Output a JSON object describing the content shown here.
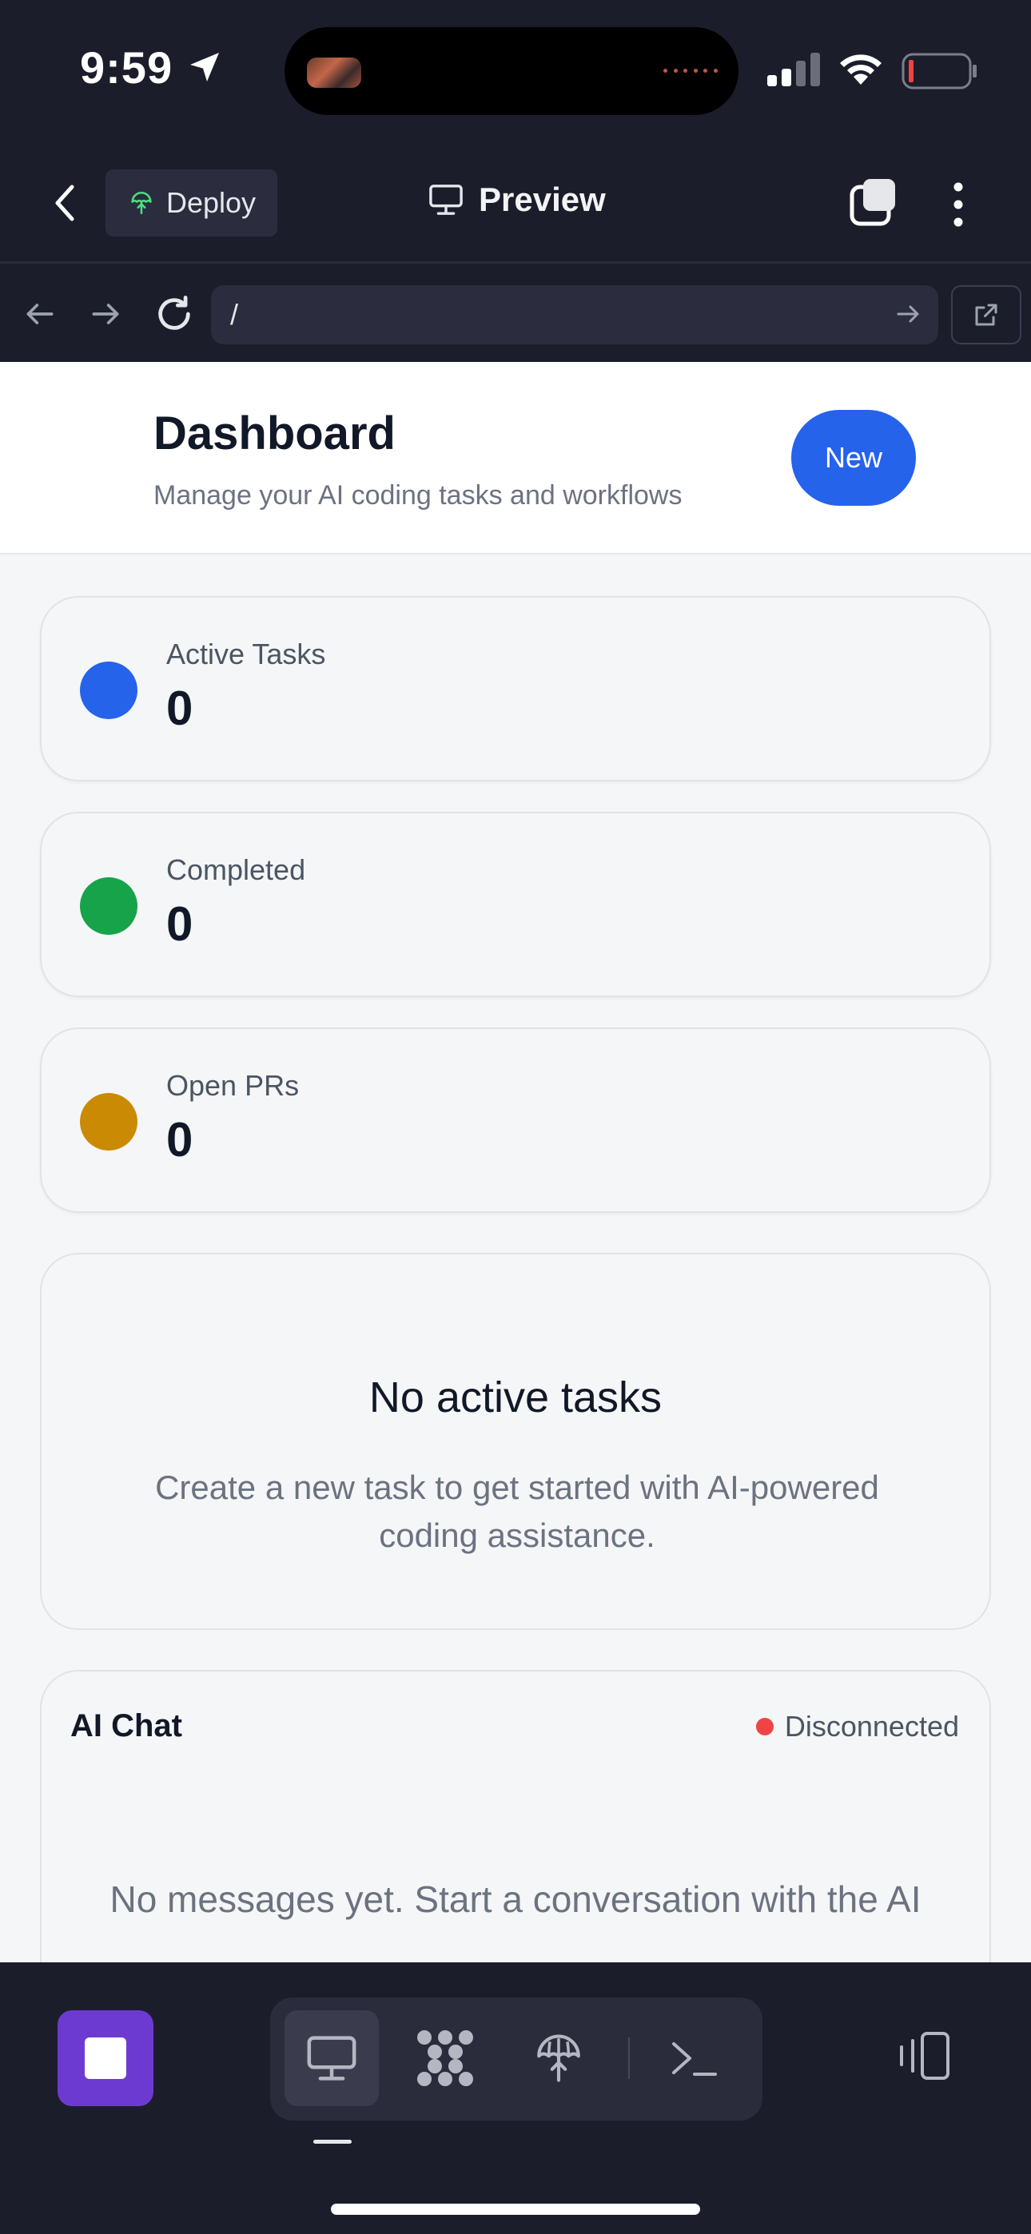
{
  "status_bar": {
    "time": "9:59"
  },
  "header": {
    "deploy_label": "Deploy",
    "title": "Preview"
  },
  "url_bar": {
    "value": "/"
  },
  "page": {
    "title": "Dashboard",
    "subtitle": "Manage your AI coding tasks and workflows",
    "new_button": "New"
  },
  "stats": [
    {
      "label": "Active Tasks",
      "value": "0",
      "color": "#2563eb"
    },
    {
      "label": "Completed",
      "value": "0",
      "color": "#16a34a"
    },
    {
      "label": "Open PRs",
      "value": "0",
      "color": "#ca8a04"
    }
  ],
  "empty_state": {
    "title": "No active tasks",
    "description": "Create a new task to get started with AI-powered coding assistance."
  },
  "chat": {
    "title": "AI Chat",
    "status": "Disconnected",
    "status_color": "#ef4444",
    "empty_message": "No messages yet. Start a conversation with the AI"
  },
  "toolbar": {
    "tools": [
      "monitor-icon",
      "pattern-icon",
      "deploy-icon",
      "terminal-icon"
    ],
    "active_tool": "monitor-icon"
  }
}
